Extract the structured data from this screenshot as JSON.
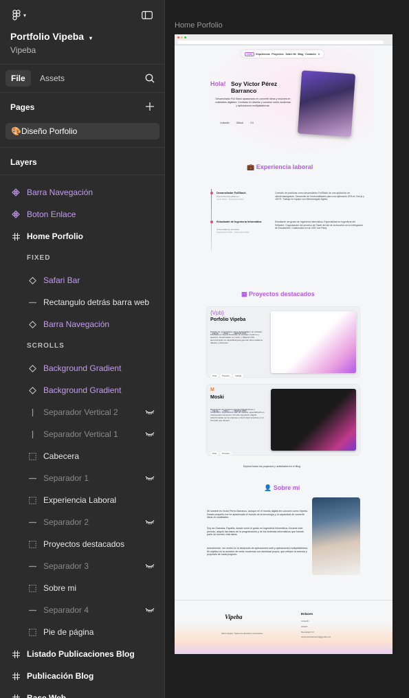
{
  "project": {
    "name": "Portfolio Vipeba",
    "team": "Vipeba"
  },
  "tabs": [
    {
      "label": "File"
    },
    {
      "label": "Assets"
    }
  ],
  "pages": {
    "title": "Pages",
    "items": [
      {
        "label": "🎨Diseño Porfolio"
      }
    ]
  },
  "layers": {
    "title": "Layers",
    "items": [
      {
        "label": "Barra Navegación",
        "icon": "component-icon",
        "style": "purple"
      },
      {
        "label": "Boton Enlace",
        "icon": "component-icon",
        "style": "purple"
      },
      {
        "label": "Home Porfolio",
        "icon": "frame-icon",
        "style": "white"
      },
      {
        "label": "FIXED",
        "type": "group"
      },
      {
        "label": "Safari Bar",
        "icon": "instance-icon",
        "style": "purple"
      },
      {
        "label": "Rectangulo detrás barra web",
        "icon": "line-icon",
        "style": "normal"
      },
      {
        "label": "Barra Navegación",
        "icon": "instance-icon",
        "style": "purple"
      },
      {
        "label": "SCROLLS",
        "type": "group"
      },
      {
        "label": "Background Gradient",
        "icon": "instance-icon",
        "style": "purple"
      },
      {
        "label": "Background Gradient",
        "icon": "instance-icon",
        "style": "purple"
      },
      {
        "label": "Separador Vertical 2",
        "icon": "vline-icon",
        "style": "dim",
        "hidden": true
      },
      {
        "label": "Separador Vertical 1",
        "icon": "vline-icon",
        "style": "dim",
        "hidden": true
      },
      {
        "label": "Cabecera",
        "icon": "section-icon",
        "style": "normal"
      },
      {
        "label": "Separador 1",
        "icon": "line-icon",
        "style": "dim",
        "hidden": true
      },
      {
        "label": "Experiencia Laboral",
        "icon": "section-icon",
        "style": "normal"
      },
      {
        "label": "Separador 2",
        "icon": "line-icon",
        "style": "dim",
        "hidden": true
      },
      {
        "label": "Proyectos destacados",
        "icon": "section-icon",
        "style": "normal"
      },
      {
        "label": "Separador 3",
        "icon": "line-icon",
        "style": "dim",
        "hidden": true
      },
      {
        "label": "Sobre mi",
        "icon": "section-icon",
        "style": "normal"
      },
      {
        "label": "Separador 4",
        "icon": "line-icon",
        "style": "dim",
        "hidden": true
      },
      {
        "label": "Pie de página",
        "icon": "section-icon",
        "style": "normal"
      },
      {
        "label": "Listado Publicaciones Blog",
        "icon": "frame-icon",
        "style": "white"
      },
      {
        "label": "Publicación Blog",
        "icon": "frame-icon",
        "style": "white"
      },
      {
        "label": "Base Web",
        "icon": "frame-icon",
        "style": "white"
      }
    ]
  },
  "canvas": {
    "frame_label": "Home Porfolio",
    "nav": [
      "{vpb}",
      "Experiencia",
      "Proyectos",
      "Sobre Mí",
      "Blog",
      "Contacto"
    ],
    "hero": {
      "hola": "Hola!",
      "name": "Soy Víctor Pérez Barranco",
      "desc": "Desarrollador Full Stack apasionado en convertir ideas y visiones en realidades digitales. Centrado en diseñar y construir webs modernas y aplicaciones multiplataforma.",
      "links": [
        "LinkedIn",
        "Github",
        "CV"
      ]
    },
    "experience": {
      "title": "Experiencia laboral",
      "jobs": [
        {
          "role": "Desarrollador FullStack",
          "company": "Diseño/MovilApp/Barrios",
          "dates": "Junio 2024 – Diciembre 2024",
          "desc": "Contrato de prácticas como desarrollador FullStack de una aplicación de cliente/navegación. Desarrollo de funcionalidades para una aplicación SPA en Vue.js y JS/TS. Trabajo en equipo con Metodologías Ágiles."
        },
        {
          "role": "Estudiante de Ingeniería Informática",
          "company": "Universidad de Granada",
          "dates": "Septiembre 2019 – Diciembre 2024",
          "desc": "Estudiante del grado de Ingeniería Informática. Especialidad en Ingeniería del Software. Organización del proceso de Padel del día de la escuela con la Delegación de Estudiantes. Colaborador en la UGR Lan Party."
        }
      ]
    },
    "projects": {
      "title": "Proyectos destacados",
      "items": [
        {
          "logo": "{Vpb}",
          "name": "Porfolio Vipeba",
          "tags": [
            "Figma",
            "Astro",
            "Tailwind CSS"
          ],
          "desc": "Porfolio de presentación como desarrollador de software. Diseñado en Figma buscando un enfoque moderno y atractivo. Desarrollado con Astro y Tailwind CSS aprovechando su capacidad para generar sitios estáticos rápidos y eficientes.",
          "buttons": [
            "Post",
            "Preview",
            "Código"
          ]
        },
        {
          "logo": "M",
          "name": "Moski",
          "tags": [
            "Figma",
            "Astro",
            "Tailwind CSS"
          ],
          "desc": "Renovación de producto real de Original Music y CentreMFC. Reproductor web de música, especializado en música para comercios. Permite reproducir playlist seleccionadas por la empresa e interrumpir anuncios en el intervalo que desees.",
          "buttons": [
            "Post",
            "Preview"
          ]
        }
      ],
      "explore": "Explora todos los proyectos y actividades en el Blog"
    },
    "about": {
      "title": "Sobre mí",
      "p1": "Mi nombre es Víctor Pérez Barranco, aunque en el mundo digital me conocen como Vipeba. Desde pequeño me he apasionado el mundo de la tecnología y la capacidad de convertir ideas en realidades.",
      "p2": "Soy de Granada, España, donde cursé el grado en Ingeniería Informática. Durante este periodo, adquirí las bases de la programación y de los sistemas informáticos que forman parte de nuestro vida diaria.",
      "p3": "Actualmente, me centro en el desarrollo de aplicaciones web y aplicaciones multiplataforma. Mi objetivo es la creación de webs modernas con identidad propia, que reflejen la esencia y propósito de cada proyecto."
    },
    "footer": {
      "brand": "Vipeba",
      "copy": "2024 Vipeba. Todos los derechos reservados.",
      "links_title": "Enlaces",
      "links": [
        "LinkedIn",
        "GitHub",
        "Descargar CV",
        "victorperezbarranco@gmail.com"
      ]
    }
  }
}
